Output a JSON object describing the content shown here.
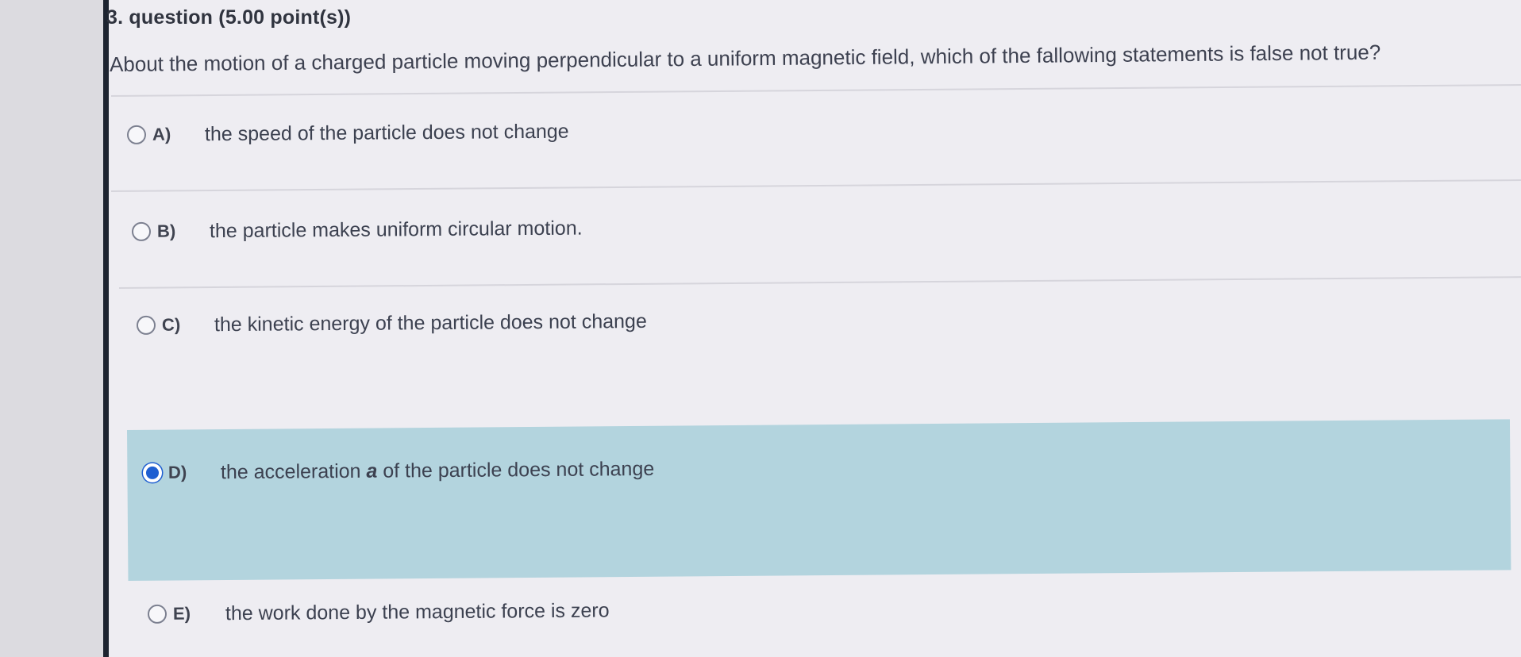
{
  "question": {
    "title": "3. question (5.00 point(s))",
    "text": "About the motion of a charged particle moving perpendicular to a uniform magnetic field, which of the fallowing statements is false not true?"
  },
  "options": [
    {
      "letter": "A)",
      "text": "the speed of the particle does not change",
      "selected": false
    },
    {
      "letter": "B)",
      "text": "the particle makes uniform circular motion.",
      "selected": false
    },
    {
      "letter": "C)",
      "text": "the kinetic energy of the particle does not change",
      "selected": false
    },
    {
      "letter": "D)",
      "text_before": "the acceleration ",
      "text_var": "a",
      "text_after": " of the particle does not change",
      "selected": true
    },
    {
      "letter": "E)",
      "text": "the work done by the magnetic force is zero",
      "selected": false
    }
  ],
  "colors": {
    "selected_background": "#b3d4de",
    "radio_selected": "#1f5fd1"
  }
}
